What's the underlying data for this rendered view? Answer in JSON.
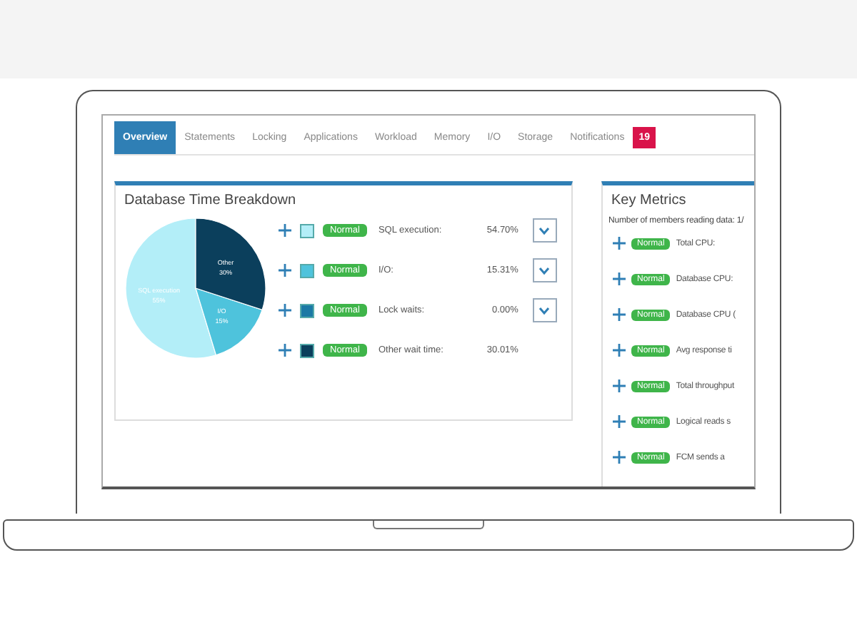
{
  "tabs": [
    {
      "label": "Overview",
      "selected": true
    },
    {
      "label": "Statements",
      "selected": false
    },
    {
      "label": "Locking",
      "selected": false
    },
    {
      "label": "Applications",
      "selected": false
    },
    {
      "label": "Workload",
      "selected": false
    },
    {
      "label": "Memory",
      "selected": false
    },
    {
      "label": "I/O",
      "selected": false
    },
    {
      "label": "Storage",
      "selected": false
    },
    {
      "label": "Notifications",
      "selected": false,
      "badge": "19"
    }
  ],
  "time_breakdown": {
    "title": "Database Time Breakdown",
    "chart_data": {
      "type": "pie",
      "values": [
        54.7,
        15.31,
        0.0,
        30.01
      ]
    },
    "rows": [
      {
        "status": "Normal",
        "color": "#b3eef8",
        "label": "SQL execution:",
        "value": "54.70%",
        "expandable": true,
        "slice_label": {
          "name": "SQL execution",
          "percent": "55%"
        }
      },
      {
        "status": "Normal",
        "color": "#4ec3dc",
        "label": "I/O:",
        "value": "15.31%",
        "expandable": true,
        "slice_label": {
          "name": "I/O",
          "percent": "15%"
        }
      },
      {
        "status": "Normal",
        "color": "#1b79a5",
        "label": "Lock waits:",
        "value": "0.00%",
        "expandable": true
      },
      {
        "status": "Normal",
        "color": "#0b3f5c",
        "label": "Other wait time:",
        "value": "30.01%",
        "expandable": false,
        "slice_label": {
          "name": "Other",
          "percent": "30%"
        }
      }
    ]
  },
  "key_metrics": {
    "title": "Key Metrics",
    "subtitle": "Number of members reading data: 1/",
    "rows": [
      {
        "status": "Normal",
        "label": "Total CPU:"
      },
      {
        "status": "Normal",
        "label": "Database CPU:"
      },
      {
        "status": "Normal",
        "label": "Database CPU ("
      },
      {
        "status": "Normal",
        "label": "Avg response ti"
      },
      {
        "status": "Normal",
        "label": "Total throughput"
      },
      {
        "status": "Normal",
        "label": "Logical reads s"
      },
      {
        "status": "Normal",
        "label": "FCM sends a"
      }
    ]
  }
}
